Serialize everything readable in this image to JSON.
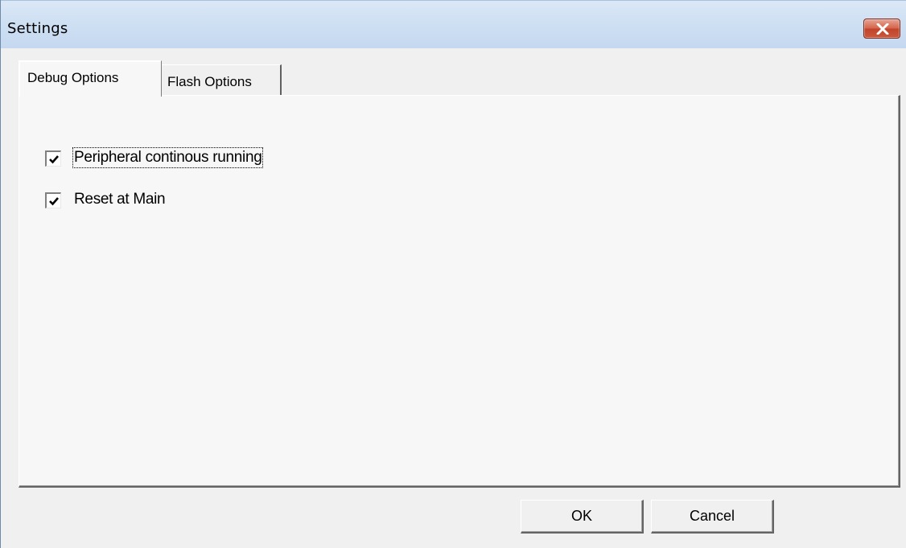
{
  "window": {
    "title": "Settings"
  },
  "tabs": [
    {
      "label": "Debug Options",
      "active": true
    },
    {
      "label": "Flash Options",
      "active": false
    }
  ],
  "debug_options": {
    "checkboxes": [
      {
        "label": "Peripheral continous running",
        "checked": true
      },
      {
        "label": "Reset at Main",
        "checked": true
      }
    ]
  },
  "buttons": {
    "ok": "OK",
    "cancel": "Cancel"
  },
  "icons": {
    "close": "close-icon",
    "check": "checkmark-icon"
  },
  "colors": {
    "close_button": "#c9583d",
    "titlebar": "#cfe0f3"
  }
}
